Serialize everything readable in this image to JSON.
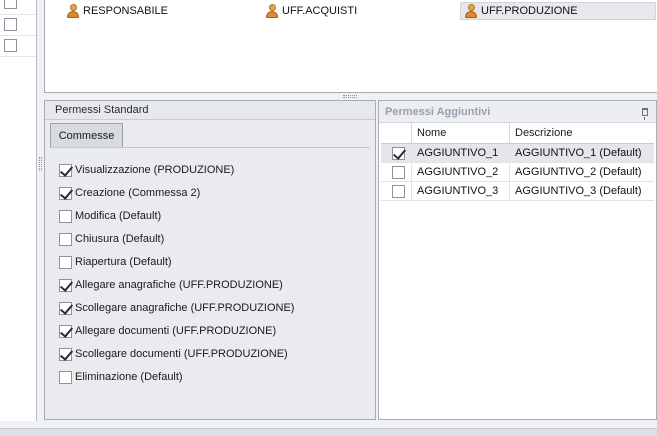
{
  "left_strip": {
    "checkboxes": [
      false,
      false,
      false
    ]
  },
  "users": [
    {
      "label": "RESPONSABILE",
      "selected": false
    },
    {
      "label": "UFF.ACQUISTI",
      "selected": false
    },
    {
      "label": "UFF.PRODUZIONE",
      "selected": true
    }
  ],
  "standard": {
    "title": "Permessi Standard",
    "tab": "Commesse",
    "permissions": [
      {
        "label": "Visualizzazione (PRODUZIONE)",
        "checked": true
      },
      {
        "label": "Creazione (Commessa 2)",
        "checked": true
      },
      {
        "label": "Modifica (Default)",
        "checked": false
      },
      {
        "label": "Chiusura (Default)",
        "checked": false
      },
      {
        "label": "Riapertura (Default)",
        "checked": false
      },
      {
        "label": "Allegare anagrafiche (UFF.PRODUZIONE)",
        "checked": true
      },
      {
        "label": "Scollegare anagrafiche (UFF.PRODUZIONE)",
        "checked": true
      },
      {
        "label": "Allegare documenti (UFF.PRODUZIONE)",
        "checked": true
      },
      {
        "label": "Scollegare documenti (UFF.PRODUZIONE)",
        "checked": true
      },
      {
        "label": "Eliminazione (Default)",
        "checked": false
      }
    ]
  },
  "additional": {
    "title": "Permessi Aggiuntivi",
    "columns": [
      "Nome",
      "Descrizione"
    ],
    "rows": [
      {
        "checked": true,
        "nome": "AGGIUNTIVO_1",
        "descrizione": "AGGIUNTIVO_1 (Default)",
        "selected": true
      },
      {
        "checked": false,
        "nome": "AGGIUNTIVO_2",
        "descrizione": "AGGIUNTIVO_2 (Default)",
        "selected": false
      },
      {
        "checked": false,
        "nome": "AGGIUNTIVO_3",
        "descrizione": "AGGIUNTIVO_3 (Default)",
        "selected": false
      }
    ]
  }
}
